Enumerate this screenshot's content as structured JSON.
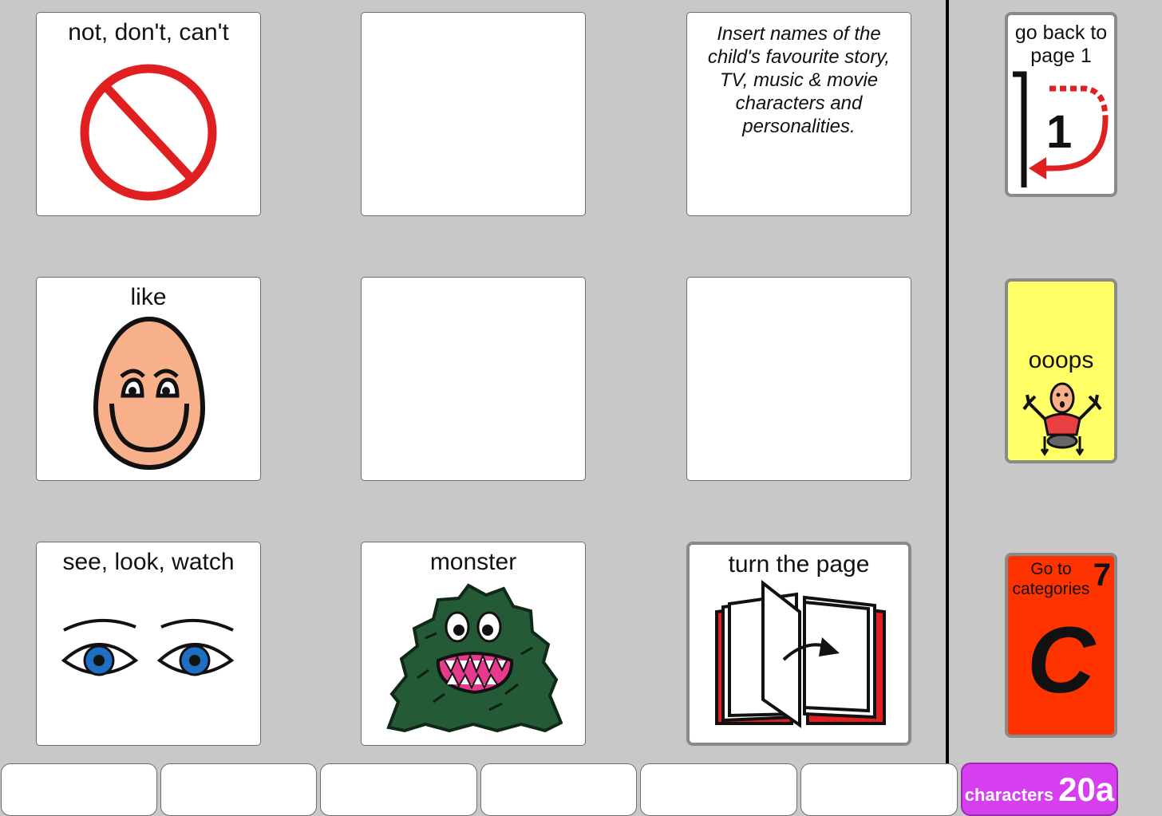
{
  "grid": [
    {
      "label": "not, don't, can't",
      "icon": "no-symbol-icon"
    },
    {
      "label": "",
      "icon": ""
    },
    {
      "note": "Insert names of the child's favourite story, TV, music & movie characters and personalities."
    },
    {
      "label": "like",
      "icon": "smiling-face-icon"
    },
    {
      "label": "",
      "icon": ""
    },
    {
      "label": "",
      "icon": ""
    },
    {
      "label": "see, look, watch",
      "icon": "eyes-icon"
    },
    {
      "label": "monster",
      "icon": "monster-icon"
    },
    {
      "label": "turn the page",
      "icon": "open-book-icon"
    }
  ],
  "sidebar": {
    "back": {
      "label": "go back to page 1",
      "number": "1",
      "icon": "return-arrow-icon"
    },
    "oops": {
      "label": "ooops",
      "icon": "dropped-plate-person-icon",
      "color": "#ffff66"
    },
    "categories": {
      "label": "Go to categories",
      "number": "7",
      "letter": "C",
      "color": "#ff3300"
    }
  },
  "page_id": {
    "category": "characters",
    "number": "20a",
    "color": "#d63ff0"
  },
  "colors": {
    "background": "#c8c8c8",
    "no_symbol": "#e02020",
    "face": "#f8b08a",
    "iris": "#1e6fc0",
    "monster": "#245a36",
    "book_red": "#e02020"
  }
}
